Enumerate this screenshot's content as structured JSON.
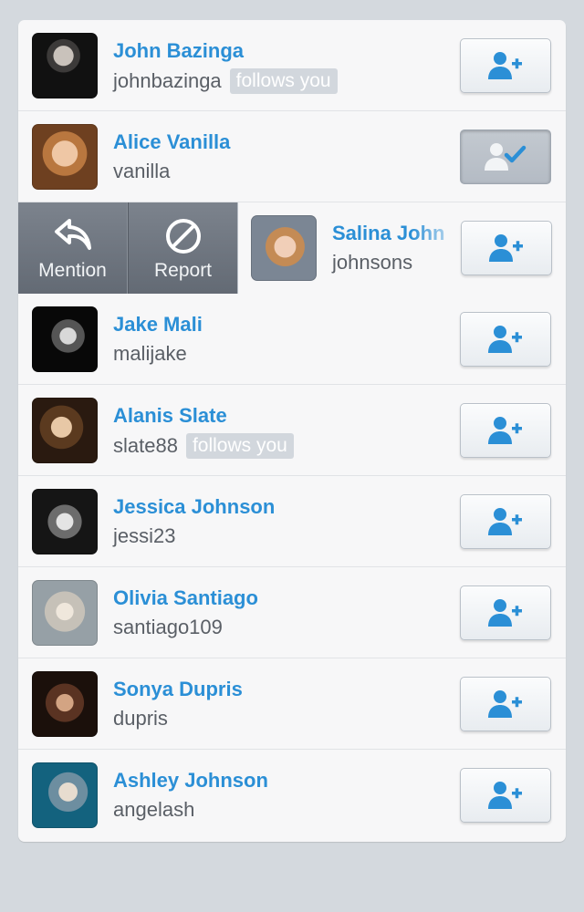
{
  "colors": {
    "accent": "#2b8fd6",
    "username": "#5a5f66",
    "badge_bg": "#d2d7dd",
    "action_bg": "#6f7680",
    "page_bg": "#d4d9de",
    "card_bg": "#f7f7f8"
  },
  "swipe_actions": [
    {
      "label": "Mention",
      "icon": "reply-icon"
    },
    {
      "label": "Report",
      "icon": "prohibited-icon"
    }
  ],
  "follow_icon": "add-user-icon",
  "following_icon": "user-check-icon",
  "users": [
    {
      "name": "John Bazinga",
      "username": "johnbazinga",
      "badge": "follows you",
      "following": false,
      "avatar": "avatar-photo"
    },
    {
      "name": "Alice Vanilla",
      "username": "vanilla",
      "badge": "",
      "following": true,
      "avatar": "avatar-photo"
    },
    {
      "name": "Salina John",
      "username": "johnsons",
      "badge": "",
      "following": false,
      "avatar": "avatar-photo",
      "swiped": true
    },
    {
      "name": "Jake Mali",
      "username": "malijake",
      "badge": "",
      "following": false,
      "avatar": "avatar-photo"
    },
    {
      "name": "Alanis Slate",
      "username": "slate88",
      "badge": "follows you",
      "following": false,
      "avatar": "avatar-photo"
    },
    {
      "name": "Jessica Johnson",
      "username": "jessi23",
      "badge": "",
      "following": false,
      "avatar": "avatar-photo"
    },
    {
      "name": "Olivia Santiago",
      "username": "santiago109",
      "badge": "",
      "following": false,
      "avatar": "avatar-photo"
    },
    {
      "name": "Sonya Dupris",
      "username": "dupris",
      "badge": "",
      "following": false,
      "avatar": "avatar-photo"
    },
    {
      "name": "Ashley Johnson",
      "username": "angelash",
      "badge": "",
      "following": false,
      "avatar": "avatar-photo"
    }
  ]
}
